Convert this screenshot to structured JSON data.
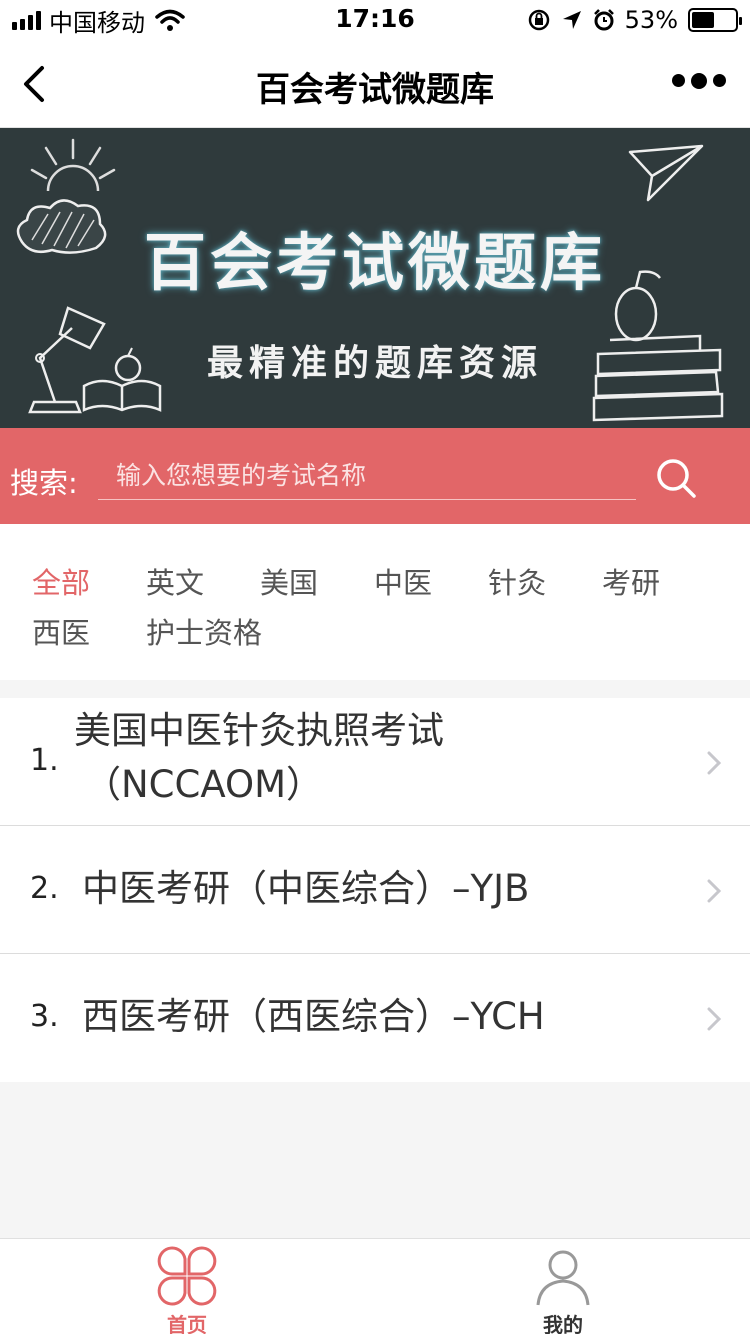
{
  "status_bar": {
    "carrier": "中国移动",
    "time": "17:16",
    "battery_percent_text": "53%",
    "battery_level": 0.53
  },
  "nav": {
    "title": "百会考试微题库",
    "back_icon": "chevron-left-icon",
    "more_icon": "more-dots-icon"
  },
  "banner": {
    "title": "百会考试微题库",
    "subtitle": "最精准的题库资源"
  },
  "search": {
    "label": "搜索:",
    "placeholder": "输入您想要的考试名称",
    "value": "",
    "icon": "search-icon"
  },
  "categories": [
    {
      "label": "全部",
      "active": true
    },
    {
      "label": "英文",
      "active": false
    },
    {
      "label": "美国",
      "active": false
    },
    {
      "label": "中医",
      "active": false
    },
    {
      "label": "针灸",
      "active": false
    },
    {
      "label": "考研",
      "active": false
    },
    {
      "label": "西医",
      "active": false
    },
    {
      "label": "护士资格",
      "active": false
    }
  ],
  "exams": [
    {
      "num": "1.",
      "line1": "美国中医针灸执照考试",
      "line2": "（NCCAOM）"
    },
    {
      "num": "2.",
      "line1": "中医考研（中医综合）–YJB",
      "line2": ""
    },
    {
      "num": "3.",
      "line1": "西医考研（西医综合）–YCH",
      "line2": ""
    }
  ],
  "tabs": [
    {
      "label": "首页",
      "icon": "clover-home-icon",
      "active": true
    },
    {
      "label": "我的",
      "icon": "person-icon",
      "active": false
    }
  ],
  "colors": {
    "accent": "#e26668",
    "banner_bg": "#2f3a3c",
    "tab_inactive": "#333333"
  }
}
